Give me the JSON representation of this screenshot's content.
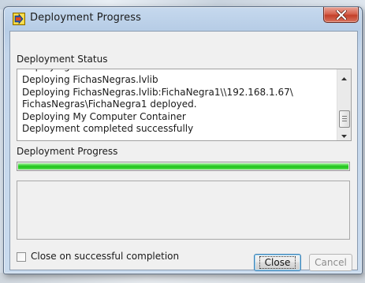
{
  "window": {
    "title": "Deployment Progress"
  },
  "status": {
    "label": "Deployment Status",
    "lines": [
      "Deploying FichasNegras.lvlib",
      "Deploying FichasNegras.lvlib:FichaNegra1\\\\192.168.1.67\\",
      "FichasNegras\\FichaNegra1 deployed.",
      "Deploying My Computer Container",
      "Deployment completed successfully"
    ]
  },
  "progress": {
    "label": "Deployment Progress",
    "value": 1.0,
    "color": "#1ec31a"
  },
  "options": {
    "close_on_complete_label": "Close on successful completion",
    "close_on_complete_checked": false
  },
  "buttons": {
    "close_label": "Close",
    "cancel_label": "Cancel"
  },
  "icons": {
    "app": "labview-deploy-icon",
    "window_close": "close-icon",
    "scroll_up": "scroll-up-arrow-icon",
    "scroll_down": "scroll-down-arrow-icon"
  }
}
